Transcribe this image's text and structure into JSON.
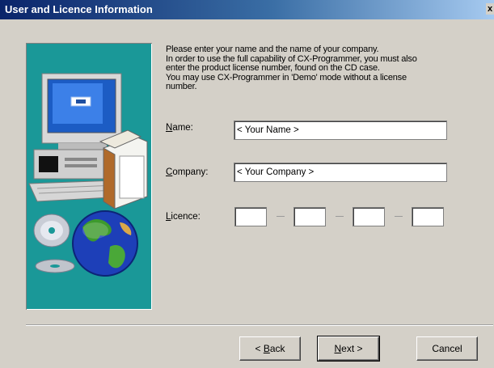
{
  "window": {
    "title": "User and Licence Information",
    "close_glyph": "x"
  },
  "intro": {
    "text": "Please enter your name and the name of your company.\nIn order to use the full capability of CX-Programmer, you must also\nenter the product license number, found on the CD case.\nYou may use CX-Programmer in 'Demo' mode without a license\nnumber."
  },
  "form": {
    "name": {
      "label_mnemonic": "N",
      "label_rest": "ame:",
      "value": "< Your Name >"
    },
    "company": {
      "label_mnemonic": "C",
      "label_rest": "ompany:",
      "value": "< Your Company >"
    },
    "licence": {
      "label_mnemonic": "L",
      "label_rest": "icence:",
      "segments": [
        "",
        "",
        "",
        ""
      ]
    }
  },
  "buttons": {
    "back": {
      "prefix": "< ",
      "mnemonic": "B",
      "rest": "ack"
    },
    "next": {
      "mnemonic": "N",
      "rest": "ext >"
    },
    "cancel": {
      "label": "Cancel"
    }
  },
  "illustration": {
    "icons": [
      "computer-icon",
      "box-icon",
      "cd-icon",
      "globe-icon"
    ]
  }
}
